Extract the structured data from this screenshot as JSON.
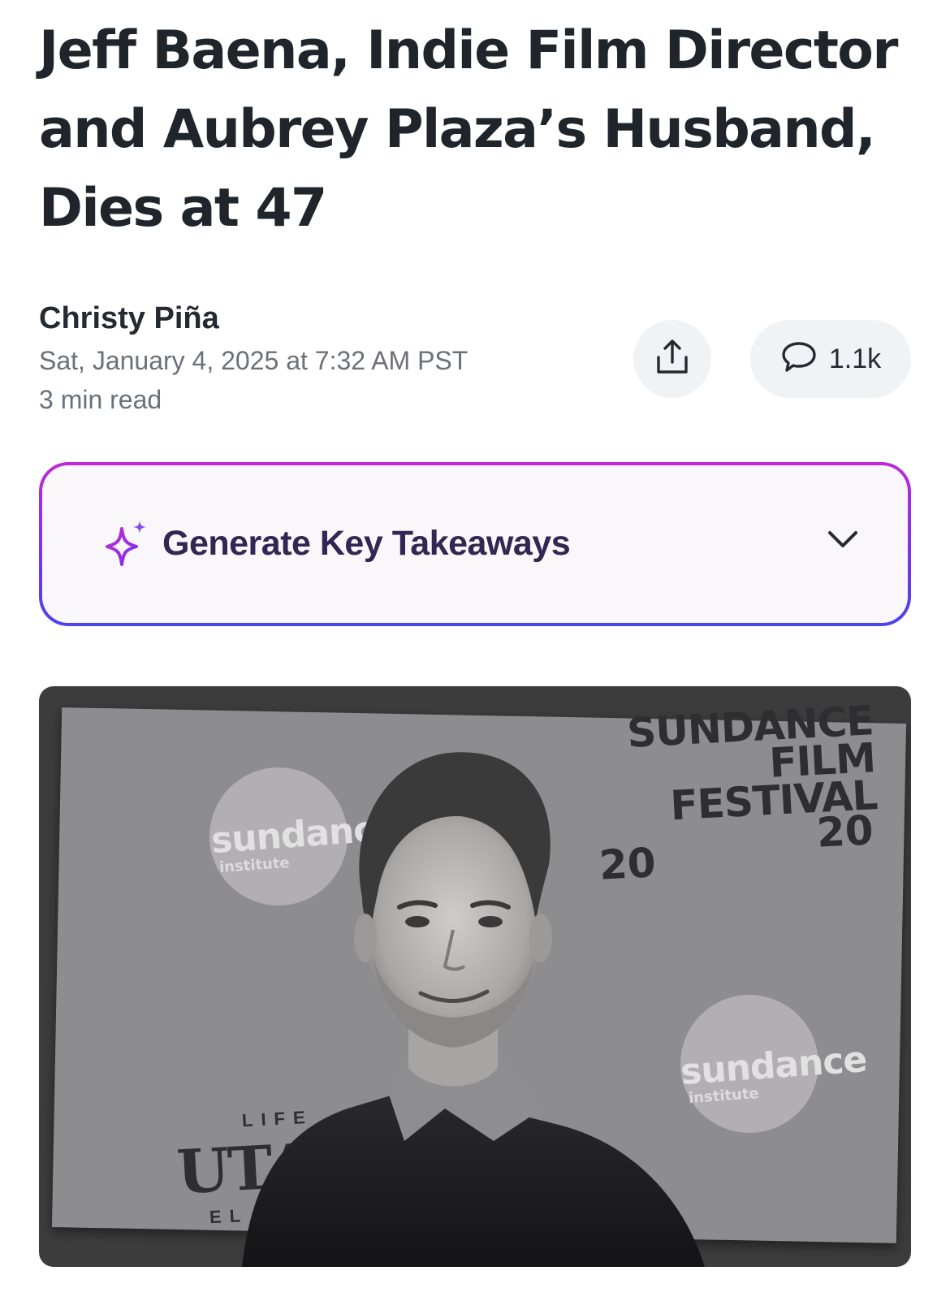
{
  "article": {
    "headline": "Jeff Baena, Indie Film Director and Aubrey Plaza’s Husband, Dies at 47",
    "author": "Christy Piña",
    "published": "Sat, January 4, 2025 at 7:32 AM PST",
    "read_time": "3 min read"
  },
  "actions": {
    "share_icon": "share-icon",
    "comment_icon": "comment-bubble-icon",
    "comment_count": "1.1k"
  },
  "takeaways": {
    "label": "Generate Key Takeaways",
    "icon": "sparkle-icon",
    "toggle_icon": "chevron-down-icon",
    "border_colors": [
      "#c02ad6",
      "#4a43f0"
    ]
  },
  "hero_image": {
    "backdrop_text": {
      "festival_lines": [
        "SUNDANCE",
        "FILM",
        "FESTIVAL"
      ],
      "year_left": "20",
      "year_right": "20",
      "logo_word_left": "sundanc",
      "logo_sub_left": "institute",
      "logo_word_right": "sundance",
      "logo_sub_right": "institute",
      "sponsor_top": "LIFE",
      "sponsor_main": "UTA",
      "sponsor_bottom": "EL"
    }
  }
}
